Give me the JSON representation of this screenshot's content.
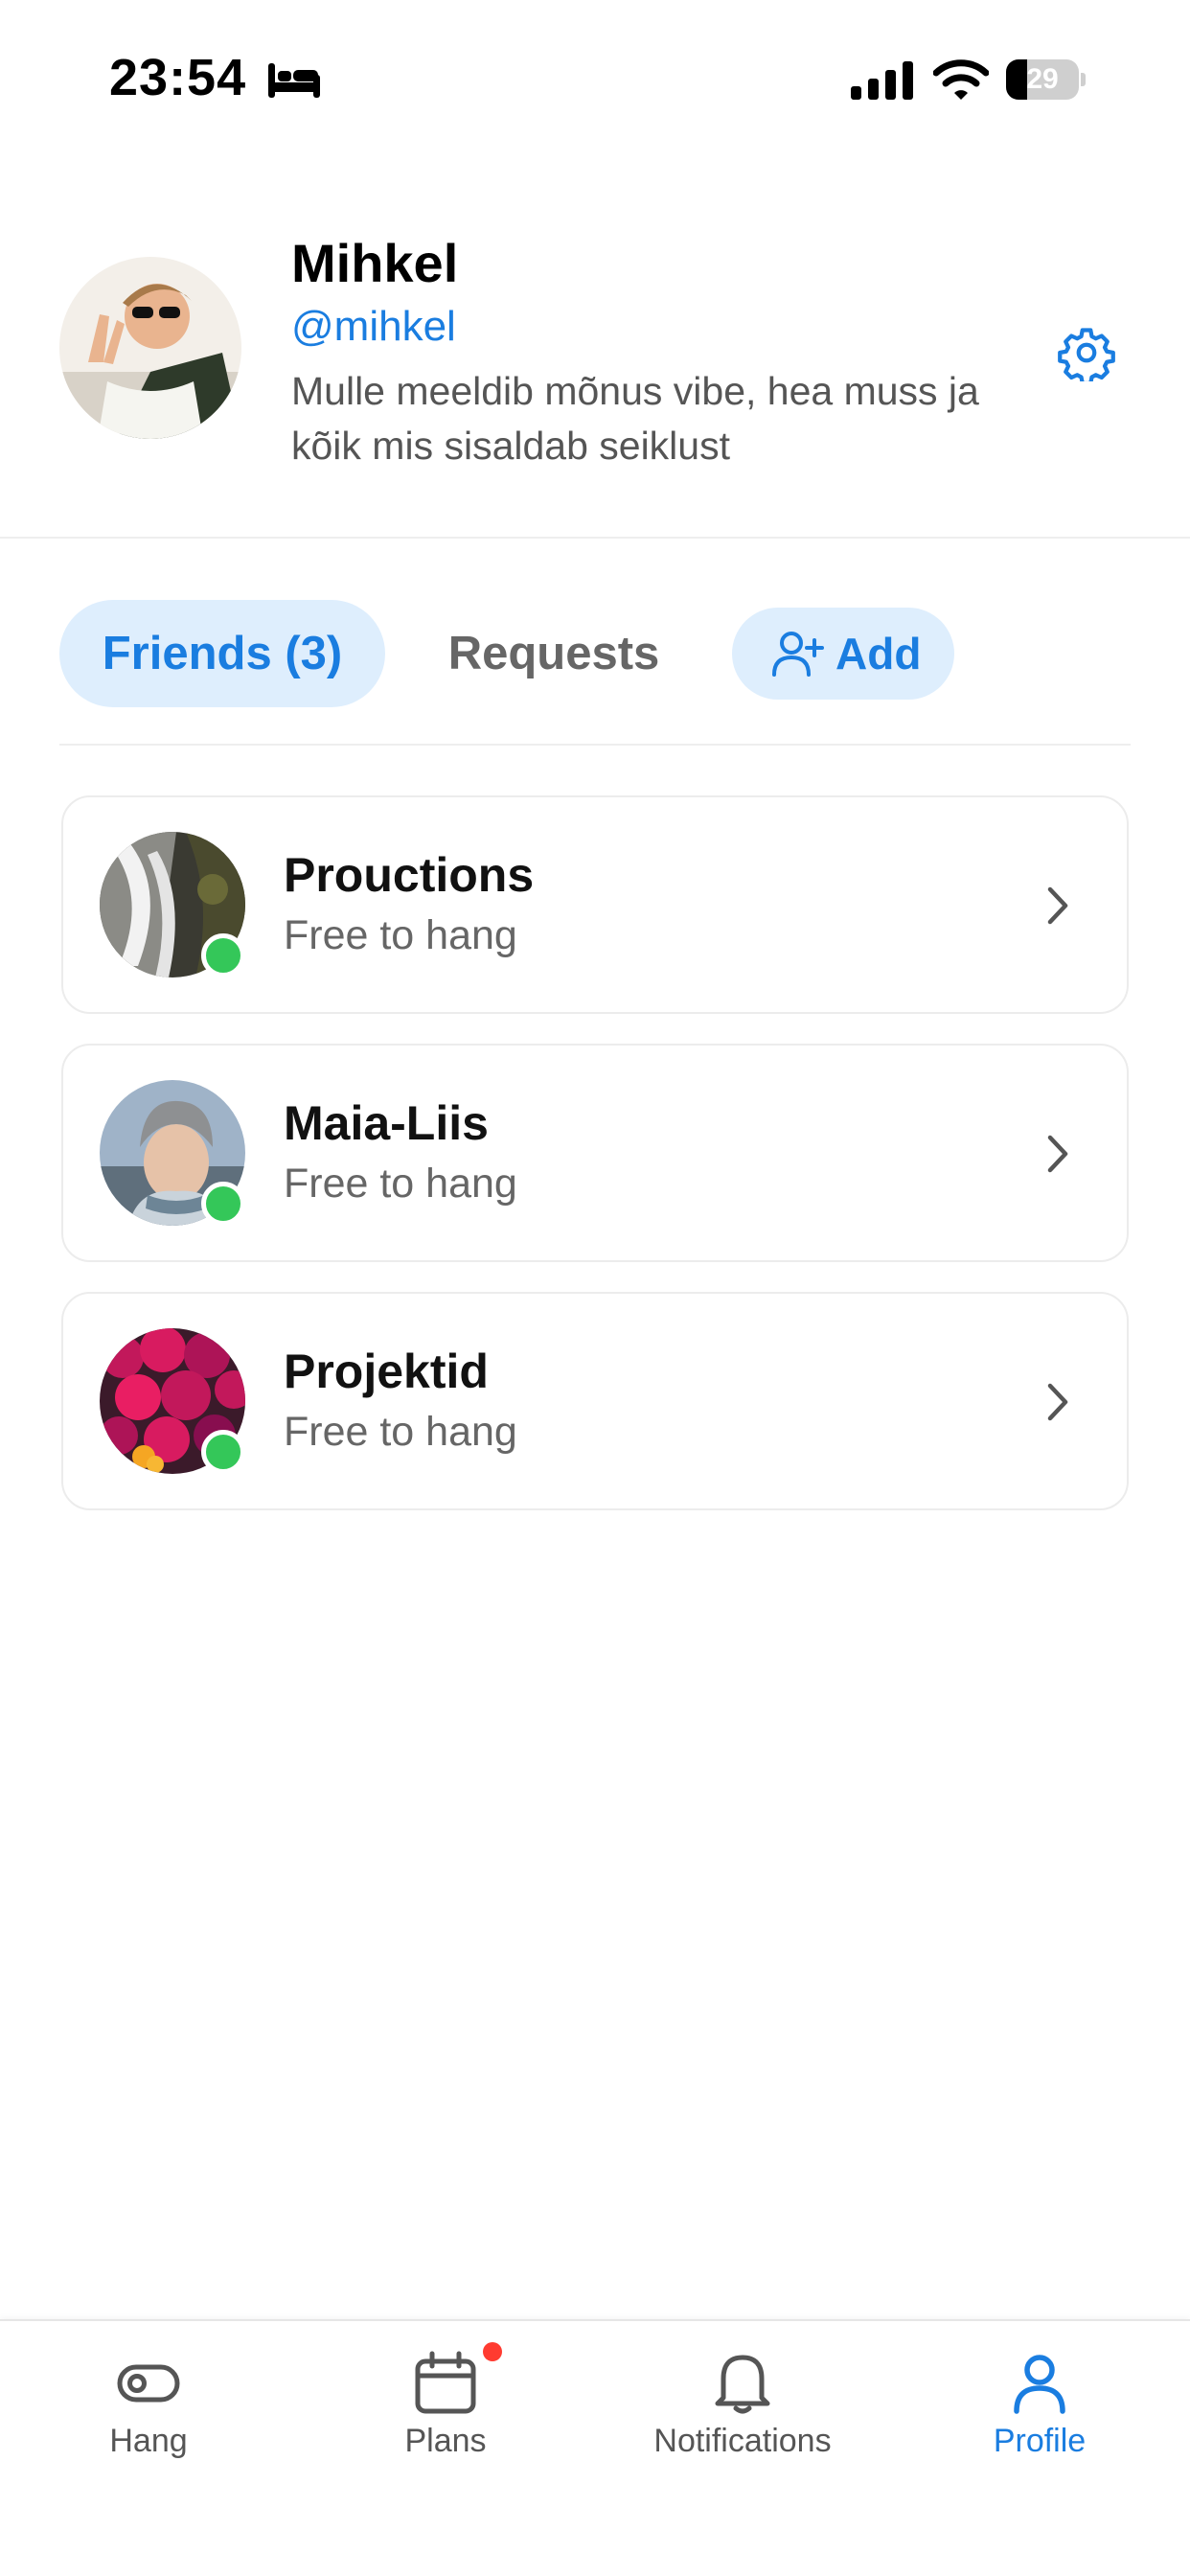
{
  "status_bar": {
    "time": "23:54",
    "battery": "29",
    "battery_level": 0.29,
    "icons": [
      "bed-icon",
      "signal-icon",
      "wifi-icon",
      "battery-icon"
    ]
  },
  "profile": {
    "name": "Mihkel",
    "handle": "@mihkel",
    "bio": "Mulle meeldib mõnus vibe, hea muss ja kõik mis sisaldab seiklust",
    "settings_icon": "gear-icon"
  },
  "tabs": {
    "friends_label": "Friends (3)",
    "requests_label": "Requests",
    "add_label": "Add",
    "add_icon": "add-person-icon"
  },
  "friends": [
    {
      "name": "Prouctions",
      "status": "Free to hang",
      "online": true
    },
    {
      "name": "Maia-Liis",
      "status": "Free to hang",
      "online": true
    },
    {
      "name": "Projektid",
      "status": "Free to hang",
      "online": true
    }
  ],
  "tab_bar": {
    "items": [
      {
        "label": "Hang",
        "icon": "toggle-icon",
        "active": false
      },
      {
        "label": "Plans",
        "icon": "calendar-icon",
        "active": false,
        "badge": true
      },
      {
        "label": "Notifications",
        "icon": "bell-icon",
        "active": false
      },
      {
        "label": "Profile",
        "icon": "person-icon",
        "active": true
      }
    ]
  },
  "colors": {
    "accent": "#1a7de0",
    "accent_bg": "#deeefd",
    "online": "#34c759",
    "badge": "#ff3b30",
    "muted_text": "#666666"
  }
}
